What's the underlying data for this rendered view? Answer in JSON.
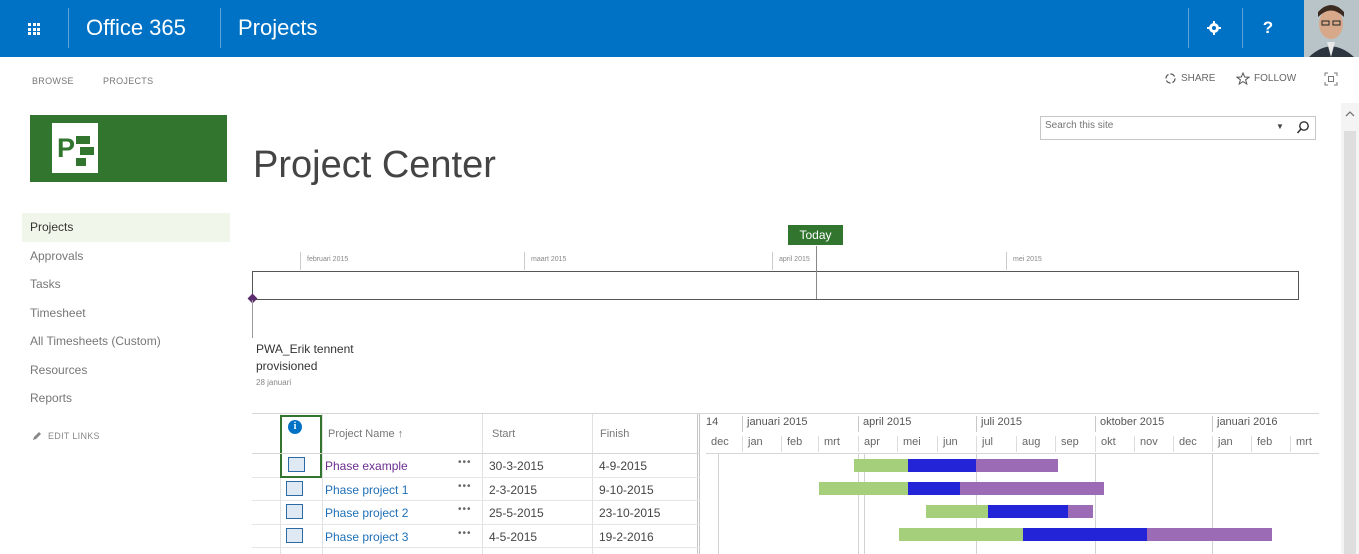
{
  "suite_bar": {
    "app_name": "Office 365",
    "site_name": "Projects",
    "settings_icon": "gear-icon",
    "help_label": "?",
    "avatar": "user-avatar"
  },
  "ribbon": {
    "tabs": [
      "BROWSE",
      "PROJECTS"
    ],
    "share_label": "SHARE",
    "follow_label": "FOLLOW"
  },
  "search": {
    "placeholder": "Search this site"
  },
  "page": {
    "title": "Project Center"
  },
  "left_nav": {
    "items": [
      {
        "label": "Projects"
      },
      {
        "label": "Approvals"
      },
      {
        "label": "Tasks"
      },
      {
        "label": "Timesheet"
      },
      {
        "label": "All Timesheets (Custom)"
      },
      {
        "label": "Resources"
      },
      {
        "label": "Reports"
      }
    ],
    "edit_links_label": "EDIT LINKS"
  },
  "timeline": {
    "today_label": "Today",
    "months": [
      "februari 2015",
      "maart 2015",
      "april 2015",
      "mei 2015"
    ],
    "milestone": {
      "title": "PWA_Erik tennent provisioned",
      "date": "28 januari"
    }
  },
  "grid": {
    "columns": [
      "Project Name ↑",
      "Start",
      "Finish"
    ],
    "rows": [
      {
        "name": "Phase example",
        "start": "30-3-2015",
        "finish": "4-9-2015"
      },
      {
        "name": "Phase project 1",
        "start": "2-3-2015",
        "finish": "9-10-2015"
      },
      {
        "name": "Phase project 2",
        "start": "25-5-2015",
        "finish": "23-10-2015"
      },
      {
        "name": "Phase project 3",
        "start": "4-5-2015",
        "finish": "19-2-2016"
      }
    ],
    "row_menu": "•••"
  },
  "gantt": {
    "quarters": [
      "14",
      "januari 2015",
      "april 2015",
      "juli 2015",
      "oktober 2015",
      "januari 2016"
    ],
    "months": [
      "dec",
      "jan",
      "feb",
      "mrt",
      "apr",
      "mei",
      "jun",
      "jul",
      "aug",
      "sep",
      "okt",
      "nov",
      "dec",
      "jan",
      "feb",
      "mrt"
    ],
    "colors": {
      "phase1": "#a5cf7a",
      "phase2": "#2323d8",
      "phase3": "#9b6bb5"
    }
  }
}
